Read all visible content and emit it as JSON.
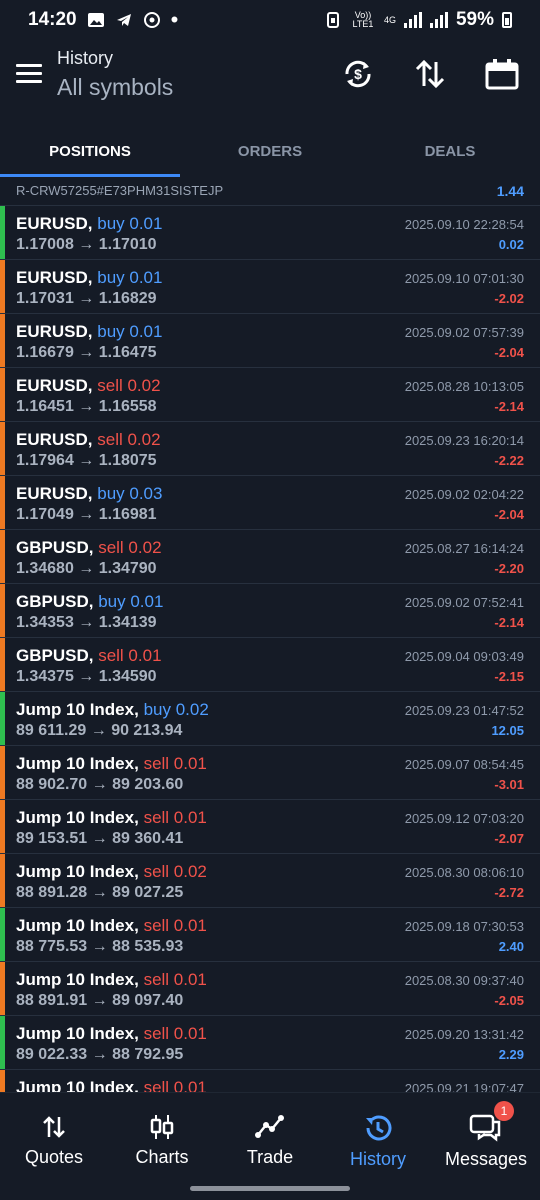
{
  "status_bar": {
    "time": "14:20",
    "volte": "Vo)) LTE1",
    "network": "4G",
    "battery": "59%"
  },
  "header": {
    "title": "History",
    "subtitle": "All symbols",
    "icons": [
      "sync-money-icon",
      "sort-icon",
      "calendar-icon"
    ]
  },
  "tabs": [
    {
      "label": "POSITIONS",
      "active": true
    },
    {
      "label": "ORDERS",
      "active": false
    },
    {
      "label": "DEALS",
      "active": false
    }
  ],
  "account": {
    "id": "R-CRW57255#E73PHM31SISTEJP",
    "value": "1.44"
  },
  "rows": [
    {
      "symbol": "EURUSD,",
      "side": "buy",
      "size": "buy 0.01",
      "prices": "1.17008 → 1.17010",
      "time": "2025.09.10 22:28:54",
      "profit": "0.02",
      "edge": "#2fbf4f"
    },
    {
      "symbol": "EURUSD,",
      "side": "buy",
      "size": "buy 0.01",
      "prices": "1.17031 → 1.16829",
      "time": "2025.09.10 07:01:30",
      "profit": "-2.02",
      "edge": "#ef7a22"
    },
    {
      "symbol": "EURUSD,",
      "side": "buy",
      "size": "buy 0.01",
      "prices": "1.16679 → 1.16475",
      "time": "2025.09.02 07:57:39",
      "profit": "-2.04",
      "edge": "#ef7a22"
    },
    {
      "symbol": "EURUSD,",
      "side": "sell",
      "size": "sell 0.02",
      "prices": "1.16451 → 1.16558",
      "time": "2025.08.28 10:13:05",
      "profit": "-2.14",
      "edge": "#ef7a22"
    },
    {
      "symbol": "EURUSD,",
      "side": "sell",
      "size": "sell 0.02",
      "prices": "1.17964 → 1.18075",
      "time": "2025.09.23 16:20:14",
      "profit": "-2.22",
      "edge": "#ef7a22"
    },
    {
      "symbol": "EURUSD,",
      "side": "buy",
      "size": "buy 0.03",
      "prices": "1.17049 → 1.16981",
      "time": "2025.09.02 02:04:22",
      "profit": "-2.04",
      "edge": "#ef7a22"
    },
    {
      "symbol": "GBPUSD,",
      "side": "sell",
      "size": "sell 0.02",
      "prices": "1.34680 → 1.34790",
      "time": "2025.08.27 16:14:24",
      "profit": "-2.20",
      "edge": "#ef7a22"
    },
    {
      "symbol": "GBPUSD,",
      "side": "buy",
      "size": "buy 0.01",
      "prices": "1.34353 → 1.34139",
      "time": "2025.09.02 07:52:41",
      "profit": "-2.14",
      "edge": "#ef7a22"
    },
    {
      "symbol": "GBPUSD,",
      "side": "sell",
      "size": "sell 0.01",
      "prices": "1.34375 → 1.34590",
      "time": "2025.09.04 09:03:49",
      "profit": "-2.15",
      "edge": "#ef7a22"
    },
    {
      "symbol": "Jump 10 Index,",
      "side": "buy",
      "size": "buy 0.02",
      "prices": "89 611.29 → 90 213.94",
      "time": "2025.09.23 01:47:52",
      "profit": "12.05",
      "edge": "#2fbf4f"
    },
    {
      "symbol": "Jump 10 Index,",
      "side": "sell",
      "size": "sell 0.01",
      "prices": "88 902.70 → 89 203.60",
      "time": "2025.09.07 08:54:45",
      "profit": "-3.01",
      "edge": "#ef7a22"
    },
    {
      "symbol": "Jump 10 Index,",
      "side": "sell",
      "size": "sell 0.01",
      "prices": "89 153.51 → 89 360.41",
      "time": "2025.09.12 07:03:20",
      "profit": "-2.07",
      "edge": "#ef7a22"
    },
    {
      "symbol": "Jump 10 Index,",
      "side": "sell",
      "size": "sell 0.02",
      "prices": "88 891.28 → 89 027.25",
      "time": "2025.08.30 08:06:10",
      "profit": "-2.72",
      "edge": "#ef7a22"
    },
    {
      "symbol": "Jump 10 Index,",
      "side": "sell",
      "size": "sell 0.01",
      "prices": "88 775.53 → 88 535.93",
      "time": "2025.09.18 07:30:53",
      "profit": "2.40",
      "edge": "#2fbf4f"
    },
    {
      "symbol": "Jump 10 Index,",
      "side": "sell",
      "size": "sell 0.01",
      "prices": "88 891.91 → 89 097.40",
      "time": "2025.08.30 09:37:40",
      "profit": "-2.05",
      "edge": "#ef7a22"
    },
    {
      "symbol": "Jump 10 Index,",
      "side": "sell",
      "size": "sell 0.01",
      "prices": "89 022.33 → 88 792.95",
      "time": "2025.09.20 13:31:42",
      "profit": "2.29",
      "edge": "#2fbf4f"
    },
    {
      "symbol": "Jump 10 Index,",
      "side": "sell",
      "size": "sell 0.01",
      "prices": "",
      "time": "2025.09.21 19:07:47",
      "profit": "",
      "edge": "#ef7a22"
    }
  ],
  "bottom_nav": [
    {
      "label": "Quotes",
      "icon": "quotes-arrows-icon",
      "active": false
    },
    {
      "label": "Charts",
      "icon": "candles-icon",
      "active": false
    },
    {
      "label": "Trade",
      "icon": "trade-line-icon",
      "active": false
    },
    {
      "label": "History",
      "icon": "history-clock-icon",
      "active": true
    },
    {
      "label": "Messages",
      "icon": "messages-icon",
      "active": false,
      "badge": "1"
    }
  ],
  "colors": {
    "background": "#151b26",
    "accent_blue": "#4f9dff",
    "sell_red": "#f0524a",
    "profit_edge": "#2fbf4f",
    "loss_edge": "#ef7a22"
  }
}
